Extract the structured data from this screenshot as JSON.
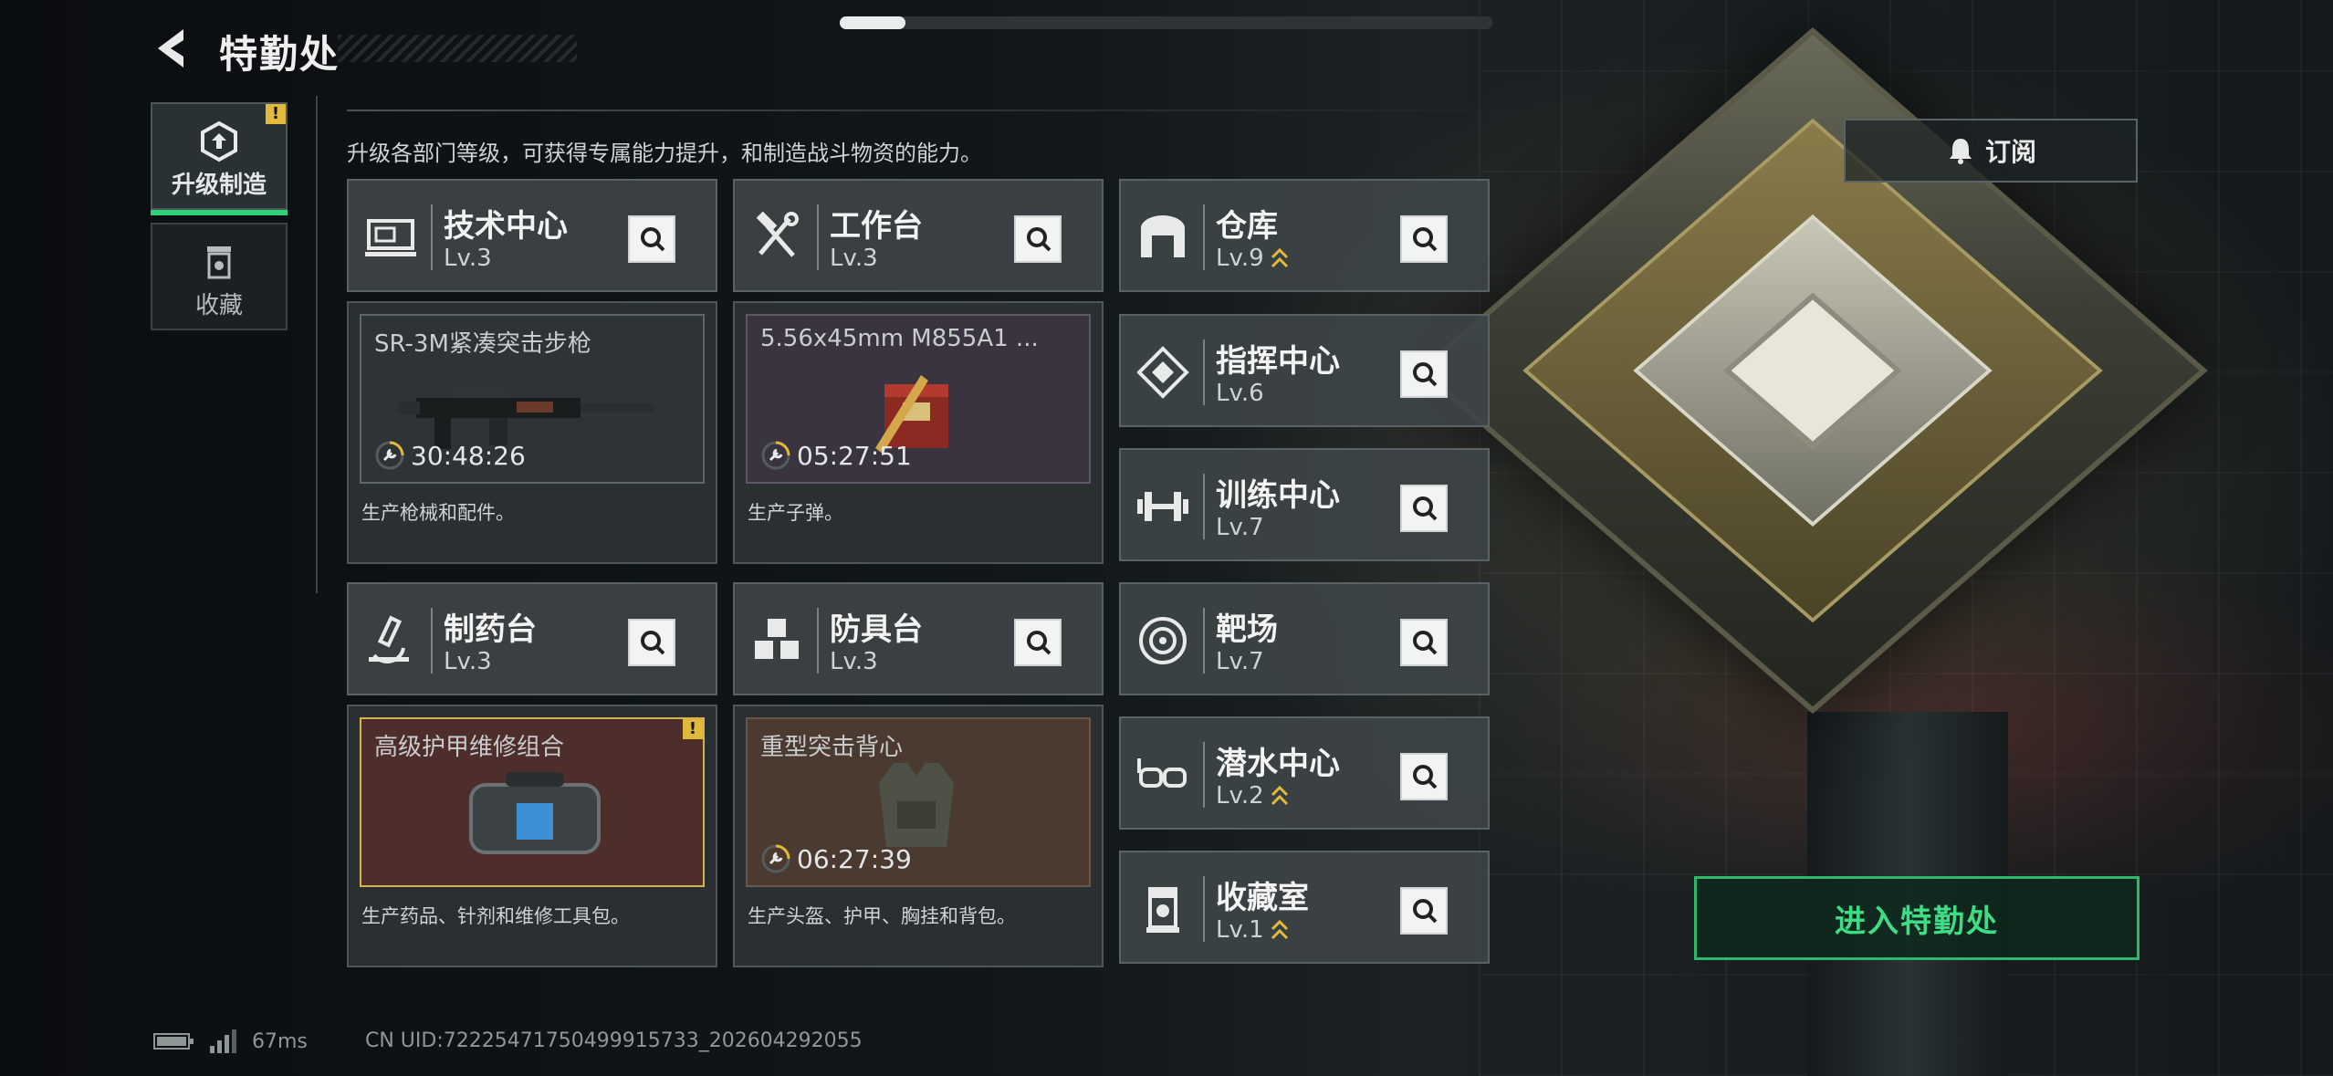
{
  "header": {
    "title": "特勤处"
  },
  "progress": {
    "value": 0.1
  },
  "tabs": [
    {
      "label": "升级制造",
      "active": true,
      "badge": "!"
    },
    {
      "label": "收藏",
      "active": false
    }
  ],
  "subtitle": "升级各部门等级，可获得专属能力提升，和制造战斗物资的能力。",
  "subscribe_label": "订阅",
  "facilities": {
    "tech_center": {
      "name": "技术中心",
      "level": "Lv.3",
      "item": "SR-3M紧凑突击步枪",
      "timer": "30:48:26",
      "desc": "生产枪械和配件。"
    },
    "workbench": {
      "name": "工作台",
      "level": "Lv.3",
      "item": "5.56x45mm M855A1 ...",
      "timer": "05:27:51",
      "desc": "生产子弹。"
    },
    "pharmacy": {
      "name": "制药台",
      "level": "Lv.3",
      "item": "高级护甲维修组合",
      "badge": "!",
      "desc": "生产药品、针剂和维修工具包。"
    },
    "armor_bench": {
      "name": "防具台",
      "level": "Lv.3",
      "item": "重型突击背心",
      "timer": "06:27:39",
      "desc": "生产头盔、护甲、胸挂和背包。"
    },
    "warehouse": {
      "name": "仓库",
      "level": "Lv.9"
    },
    "command_center": {
      "name": "指挥中心",
      "level": "Lv.6"
    },
    "training_center": {
      "name": "训练中心",
      "level": "Lv.7"
    },
    "shooting_range": {
      "name": "靶场",
      "level": "Lv.7"
    },
    "diving_center": {
      "name": "潜水中心",
      "level": "Lv.2"
    },
    "collection_room": {
      "name": "收藏室",
      "level": "Lv.1"
    }
  },
  "enter_button": "进入特勤处",
  "status": {
    "ping": "67ms",
    "uid": "CN UID:72225471750499915733_202604292055"
  },
  "colors": {
    "accent_green": "#2fd07a",
    "badge_yellow": "#e1b93c",
    "timer_ring": "#e1b93c"
  }
}
